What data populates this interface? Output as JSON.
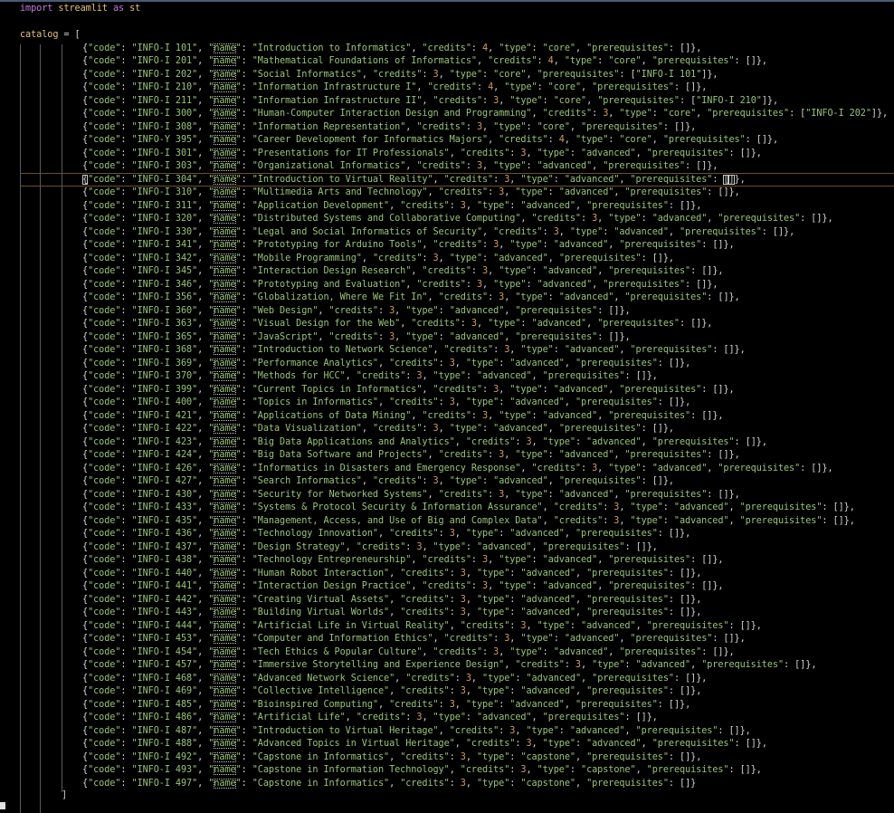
{
  "editor": {
    "import_line": {
      "keyword": "import",
      "module": "streamlit",
      "as_kw": "as",
      "alias": "st"
    },
    "assign": {
      "var": "catalog",
      "op": " = ",
      "open": "["
    },
    "close": "]",
    "active_row": 10,
    "courses": [
      {
        "code": "INFO-I 101",
        "name": "Introduction to Informatics",
        "credits": "4",
        "type": "core",
        "prereq": []
      },
      {
        "code": "INFO-I 201",
        "name": "Mathematical Foundations of Informatics",
        "credits": "4",
        "type": "core",
        "prereq": []
      },
      {
        "code": "INFO-I 202",
        "name": "Social Informatics",
        "credits": "3",
        "type": "core",
        "prereq": [
          "INFO-I 101"
        ]
      },
      {
        "code": "INFO-I 210",
        "name": "Information Infrastructure I",
        "credits": "4",
        "type": "core",
        "prereq": []
      },
      {
        "code": "INFO-I 211",
        "name": "Information Infrastructure II",
        "credits": "3",
        "type": "core",
        "prereq": [
          "INFO-I 210"
        ]
      },
      {
        "code": "INFO-I 300",
        "name": "Human-Computer Interaction Design and Programming",
        "credits": "3",
        "type": "core",
        "prereq": [
          "INFO-I 202"
        ]
      },
      {
        "code": "INFO-I 308",
        "name": "Information Representation",
        "credits": "3",
        "type": "core",
        "prereq": []
      },
      {
        "code": "INFO-Y 395",
        "name": "Career Development for Informatics Majors",
        "credits": "4",
        "type": "core",
        "prereq": []
      },
      {
        "code": "INFO-I 301",
        "name": "Presentations for IT Professionals",
        "credits": "3",
        "type": "advanced",
        "prereq": []
      },
      {
        "code": "INFO-I 303",
        "name": "Organizational Informatics",
        "credits": "3",
        "type": "advanced",
        "prereq": []
      },
      {
        "code": "INFO-I 304",
        "name": "Introduction to Virtual Reality",
        "credits": "3",
        "type": "advanced",
        "prereq": []
      },
      {
        "code": "INFO-I 310",
        "name": "Multimedia Arts and Technology",
        "credits": "3",
        "type": "advanced",
        "prereq": []
      },
      {
        "code": "INFO-I 311",
        "name": "Application Development",
        "credits": "3",
        "type": "advanced",
        "prereq": []
      },
      {
        "code": "INFO-I 320",
        "name": "Distributed Systems and Collaborative Computing",
        "credits": "3",
        "type": "advanced",
        "prereq": []
      },
      {
        "code": "INFO-I 330",
        "name": "Legal and Social Informatics of Security",
        "credits": "3",
        "type": "advanced",
        "prereq": []
      },
      {
        "code": "INFO-I 341",
        "name": "Prototyping for Arduino Tools",
        "credits": "3",
        "type": "advanced",
        "prereq": []
      },
      {
        "code": "INFO-I 342",
        "name": "Mobile Programming",
        "credits": "3",
        "type": "advanced",
        "prereq": []
      },
      {
        "code": "INFO-I 345",
        "name": "Interaction Design Research",
        "credits": "3",
        "type": "advanced",
        "prereq": []
      },
      {
        "code": "INFO-I 346",
        "name": "Prototyping and Evaluation",
        "credits": "3",
        "type": "advanced",
        "prereq": []
      },
      {
        "code": "INFO-I 356",
        "name": "Globalization, Where We Fit In",
        "credits": "3",
        "type": "advanced",
        "prereq": []
      },
      {
        "code": "INFO-I 360",
        "name": "Web Design",
        "credits": "3",
        "type": "advanced",
        "prereq": []
      },
      {
        "code": "INFO-I 363",
        "name": "Visual Design for the Web",
        "credits": "3",
        "type": "advanced",
        "prereq": []
      },
      {
        "code": "INFO-I 365",
        "name": "JavaScript",
        "credits": "3",
        "type": "advanced",
        "prereq": []
      },
      {
        "code": "INFO-I 368",
        "name": "Introduction to Network Science",
        "credits": "3",
        "type": "advanced",
        "prereq": []
      },
      {
        "code": "INFO-I 369",
        "name": "Performance Analytics",
        "credits": "3",
        "type": "advanced",
        "prereq": []
      },
      {
        "code": "INFO-I 370",
        "name": "Methods for HCC",
        "credits": "3",
        "type": "advanced",
        "prereq": []
      },
      {
        "code": "INFO-I 399",
        "name": "Current Topics in Informatics",
        "credits": "3",
        "type": "advanced",
        "prereq": []
      },
      {
        "code": "INFO-I 400",
        "name": "Topics in Informatics",
        "credits": "3",
        "type": "advanced",
        "prereq": []
      },
      {
        "code": "INFO-I 421",
        "name": "Applications of Data Mining",
        "credits": "3",
        "type": "advanced",
        "prereq": []
      },
      {
        "code": "INFO-I 422",
        "name": "Data Visualization",
        "credits": "3",
        "type": "advanced",
        "prereq": []
      },
      {
        "code": "INFO-I 423",
        "name": "Big Data Applications and Analytics",
        "credits": "3",
        "type": "advanced",
        "prereq": []
      },
      {
        "code": "INFO-I 424",
        "name": "Big Data Software and Projects",
        "credits": "3",
        "type": "advanced",
        "prereq": []
      },
      {
        "code": "INFO-I 426",
        "name": "Informatics in Disasters and Emergency Response",
        "credits": "3",
        "type": "advanced",
        "prereq": []
      },
      {
        "code": "INFO-I 427",
        "name": "Search Informatics",
        "credits": "3",
        "type": "advanced",
        "prereq": []
      },
      {
        "code": "INFO-I 430",
        "name": "Security for Networked Systems",
        "credits": "3",
        "type": "advanced",
        "prereq": []
      },
      {
        "code": "INFO-I 433",
        "name": "Systems & Protocol Security & Information Assurance",
        "credits": "3",
        "type": "advanced",
        "prereq": []
      },
      {
        "code": "INFO-I 435",
        "name": "Management, Access, and Use of Big and Complex Data",
        "credits": "3",
        "type": "advanced",
        "prereq": []
      },
      {
        "code": "INFO-I 436",
        "name": "Technology Innovation",
        "credits": "3",
        "type": "advanced",
        "prereq": []
      },
      {
        "code": "INFO-I 437",
        "name": "Design Strategy",
        "credits": "3",
        "type": "advanced",
        "prereq": []
      },
      {
        "code": "INFO-I 438",
        "name": "Technology Entrepreneurship",
        "credits": "3",
        "type": "advanced",
        "prereq": []
      },
      {
        "code": "INFO-I 440",
        "name": "Human Robot Interaction",
        "credits": "3",
        "type": "advanced",
        "prereq": []
      },
      {
        "code": "INFO-I 441",
        "name": "Interaction Design Practice",
        "credits": "3",
        "type": "advanced",
        "prereq": []
      },
      {
        "code": "INFO-I 442",
        "name": "Creating Virtual Assets",
        "credits": "3",
        "type": "advanced",
        "prereq": []
      },
      {
        "code": "INFO-I 443",
        "name": "Building Virtual Worlds",
        "credits": "3",
        "type": "advanced",
        "prereq": []
      },
      {
        "code": "INFO-I 444",
        "name": "Artificial Life in Virtual Reality",
        "credits": "3",
        "type": "advanced",
        "prereq": []
      },
      {
        "code": "INFO-I 453",
        "name": "Computer and Information Ethics",
        "credits": "3",
        "type": "advanced",
        "prereq": []
      },
      {
        "code": "INFO-I 454",
        "name": "Tech Ethics & Popular Culture",
        "credits": "3",
        "type": "advanced",
        "prereq": []
      },
      {
        "code": "INFO-I 457",
        "name": "Immersive Storytelling and Experience Design",
        "credits": "3",
        "type": "advanced",
        "prereq": []
      },
      {
        "code": "INFO-I 468",
        "name": "Advanced Network Science",
        "credits": "3",
        "type": "advanced",
        "prereq": []
      },
      {
        "code": "INFO-I 469",
        "name": "Collective Intelligence",
        "credits": "3",
        "type": "advanced",
        "prereq": []
      },
      {
        "code": "INFO-I 485",
        "name": "Bioinspired Computing",
        "credits": "3",
        "type": "advanced",
        "prereq": []
      },
      {
        "code": "INFO-I 486",
        "name": "Artificial Life",
        "credits": "3",
        "type": "advanced",
        "prereq": []
      },
      {
        "code": "INFO-I 487",
        "name": "Introduction to Virtual Heritage",
        "credits": "3",
        "type": "advanced",
        "prereq": []
      },
      {
        "code": "INFO-I 488",
        "name": "Advanced Topics in Virtual Heritage",
        "credits": "3",
        "type": "advanced",
        "prereq": []
      },
      {
        "code": "INFO-I 492",
        "name": "Capstone in Informatics",
        "credits": "3",
        "type": "capstone",
        "prereq": []
      },
      {
        "code": "INFO-I 493",
        "name": "Capstone in Information Technology",
        "credits": "3",
        "type": "capstone",
        "prereq": []
      },
      {
        "code": "INFO-I 497",
        "name": "Capstone in Informatics",
        "credits": "3",
        "type": "capstone",
        "prereq": []
      }
    ]
  }
}
